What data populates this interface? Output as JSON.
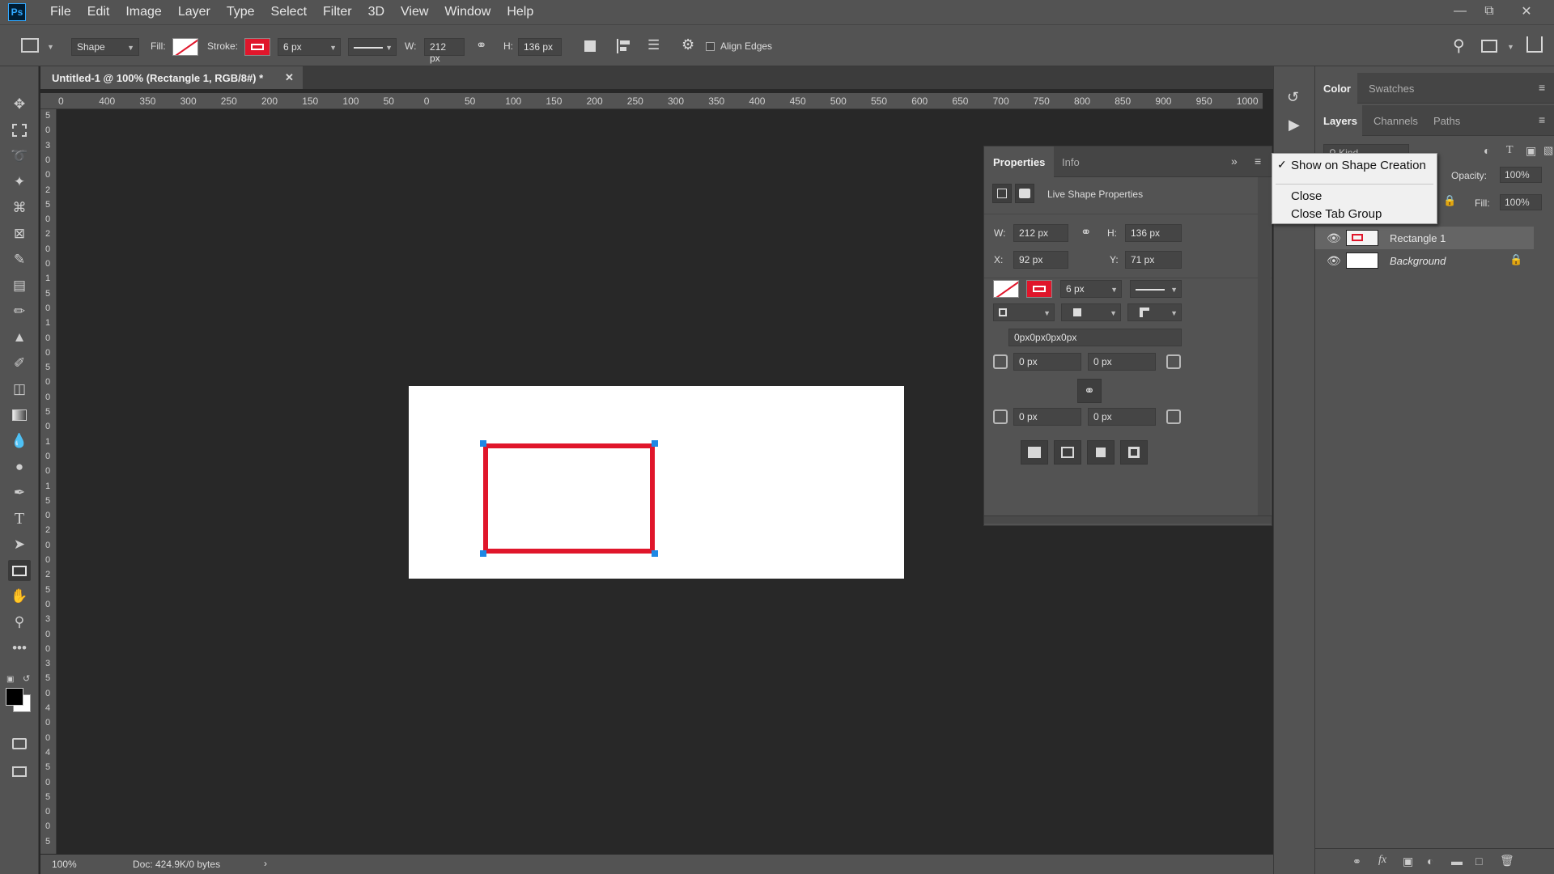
{
  "app": {
    "logo": "Ps"
  },
  "menubar": {
    "items": [
      "File",
      "Edit",
      "Image",
      "Layer",
      "Type",
      "Select",
      "Filter",
      "3D",
      "View",
      "Window",
      "Help"
    ]
  },
  "options": {
    "tool_mode": "Shape",
    "fill_label": "Fill:",
    "stroke_label": "Stroke:",
    "stroke_width": "6 px",
    "w_label": "W:",
    "w_value": "212 px",
    "h_label": "H:",
    "h_value": "136 px",
    "align_edges": "Align Edges"
  },
  "document": {
    "tab_title": "Untitled-1 @ 100% (Rectangle 1, RGB/8#) *"
  },
  "ruler": {
    "h_ticks": [
      "0",
      "400",
      "350",
      "300",
      "250",
      "200",
      "150",
      "100",
      "50",
      "0",
      "50",
      "100",
      "150",
      "200",
      "250",
      "300",
      "350",
      "400",
      "450",
      "500",
      "550",
      "600",
      "650",
      "700",
      "750",
      "800",
      "850",
      "900",
      "950",
      "1000"
    ],
    "v_ticks": [
      "5",
      "0",
      "3",
      "0",
      "0",
      "2",
      "5",
      "0",
      "2",
      "0",
      "0",
      "1",
      "5",
      "0",
      "1",
      "0",
      "0",
      "5",
      "0",
      "0",
      "5",
      "0",
      "1",
      "0",
      "0",
      "1",
      "5",
      "0",
      "2",
      "0",
      "0",
      "2",
      "5",
      "0",
      "3",
      "0",
      "0",
      "3",
      "5",
      "0",
      "4",
      "0",
      "0",
      "4",
      "5",
      "0",
      "5",
      "0",
      "0",
      "5"
    ]
  },
  "status": {
    "zoom": "100%",
    "doc": "Doc: 424.9K/0 bytes"
  },
  "properties": {
    "tab_properties": "Properties",
    "tab_info": "Info",
    "heading": "Live Shape Properties",
    "w_label": "W:",
    "w_value": "212 px",
    "h_label": "H:",
    "h_value": "136 px",
    "x_label": "X:",
    "x_value": "92 px",
    "y_label": "Y:",
    "y_value": "71 px",
    "stroke_width": "6 px",
    "radius_all": "0px0px0px0px",
    "radius_tl": "0 px",
    "radius_tr": "0 px",
    "radius_bl": "0 px",
    "radius_br": "0 px"
  },
  "right_panel": {
    "tabs_top": [
      "Color",
      "Swatches"
    ],
    "tabs_layers": [
      "Layers",
      "Channels",
      "Paths"
    ],
    "kind_placeholder": "Kind",
    "opacity_label": "Opacity:",
    "opacity_value": "100%",
    "fill_label": "Fill:",
    "fill_value": "100%",
    "layers": [
      {
        "name": "Rectangle 1"
      },
      {
        "name": "Background"
      }
    ]
  },
  "context_menu": {
    "items": [
      "Show on Shape Creation",
      "Close",
      "Close Tab Group"
    ],
    "checked_index": 0
  },
  "colors": {
    "stroke": "#e0162b",
    "handle": "#1e88e5",
    "ui_bg": "#535353",
    "workspace": "#282828"
  }
}
